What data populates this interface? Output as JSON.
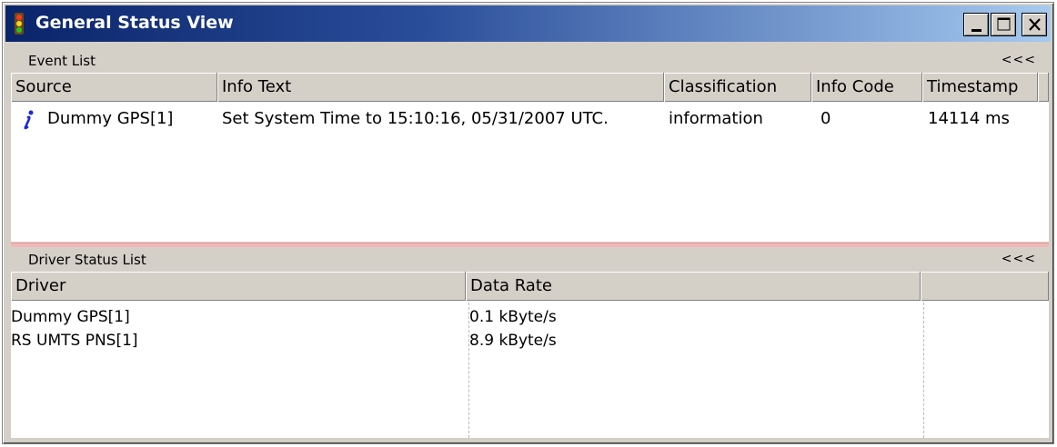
{
  "window": {
    "title": "General Status View"
  },
  "icons": {
    "title_icon": "traffic-light-icon",
    "info_icon": "info-icon"
  },
  "event_list": {
    "section_label": "Event List",
    "collapse_label": "<<<",
    "columns": [
      "Source",
      "Info Text",
      "Classification",
      "Info Code",
      "Timestamp"
    ],
    "rows": [
      {
        "source": "Dummy GPS[1]",
        "info_text": "Set System Time to 15:10:16, 05/31/2007 UTC.",
        "classification": "information",
        "info_code": "0",
        "timestamp": "14114 ms"
      }
    ]
  },
  "driver_status_list": {
    "section_label": "Driver Status List",
    "collapse_label": "<<<",
    "columns": [
      "Driver",
      "Data Rate",
      ""
    ],
    "rows": [
      {
        "driver": "Dummy GPS[1]",
        "data_rate": "0.1 kByte/s"
      },
      {
        "driver": "RS UMTS PNS[1]",
        "data_rate": "8.9 kByte/s"
      }
    ]
  },
  "colors": {
    "title_gradient_start": "#0a246a",
    "title_gradient_end": "#a6caf0",
    "splitter": "#f0b8b8",
    "face": "#d4d0c8"
  }
}
